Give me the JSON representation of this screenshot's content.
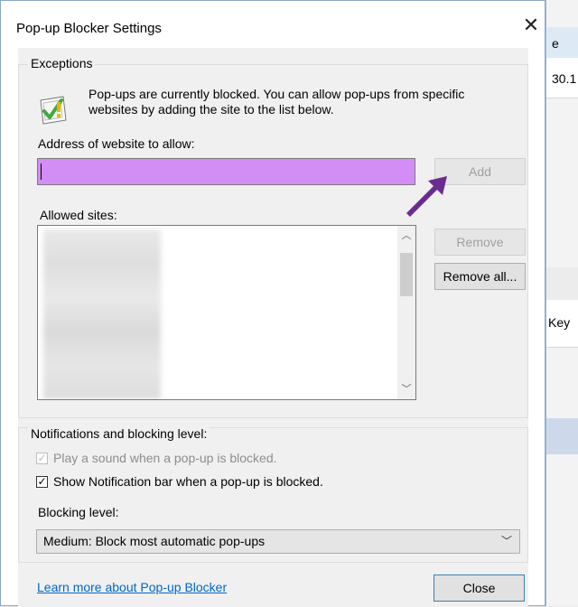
{
  "dialog": {
    "title": "Pop-up Blocker Settings",
    "close_glyph": "✕"
  },
  "exceptions": {
    "group_title": "Exceptions",
    "info_text": "Pop-ups are currently blocked.  You can allow pop-ups from specific websites by adding the site to the list below.",
    "address_label": "Address of website to allow:",
    "address_value": "",
    "add_button": "Add",
    "allowed_label": "Allowed sites:",
    "remove_button": "Remove",
    "remove_all_button": "Remove all..."
  },
  "notifications": {
    "group_title": "Notifications and blocking level:",
    "play_sound_label": "Play a sound when a pop-up is blocked.",
    "play_sound_checked": true,
    "show_bar_label": "Show Notification bar when a pop-up is blocked.",
    "show_bar_checked": true,
    "blocking_level_label": "Blocking level:",
    "blocking_level_value": "Medium: Block most automatic pop-ups"
  },
  "footer": {
    "learn_more_link": "Learn more about Pop-up Blocker",
    "close_button": "Close"
  },
  "background_window": {
    "text_1": "e",
    "text_2": "30.1",
    "text_3": "Key"
  },
  "colors": {
    "address_highlight": "#d28ef5",
    "arrow_annotation": "#6a2c91",
    "link": "#0066cc"
  }
}
